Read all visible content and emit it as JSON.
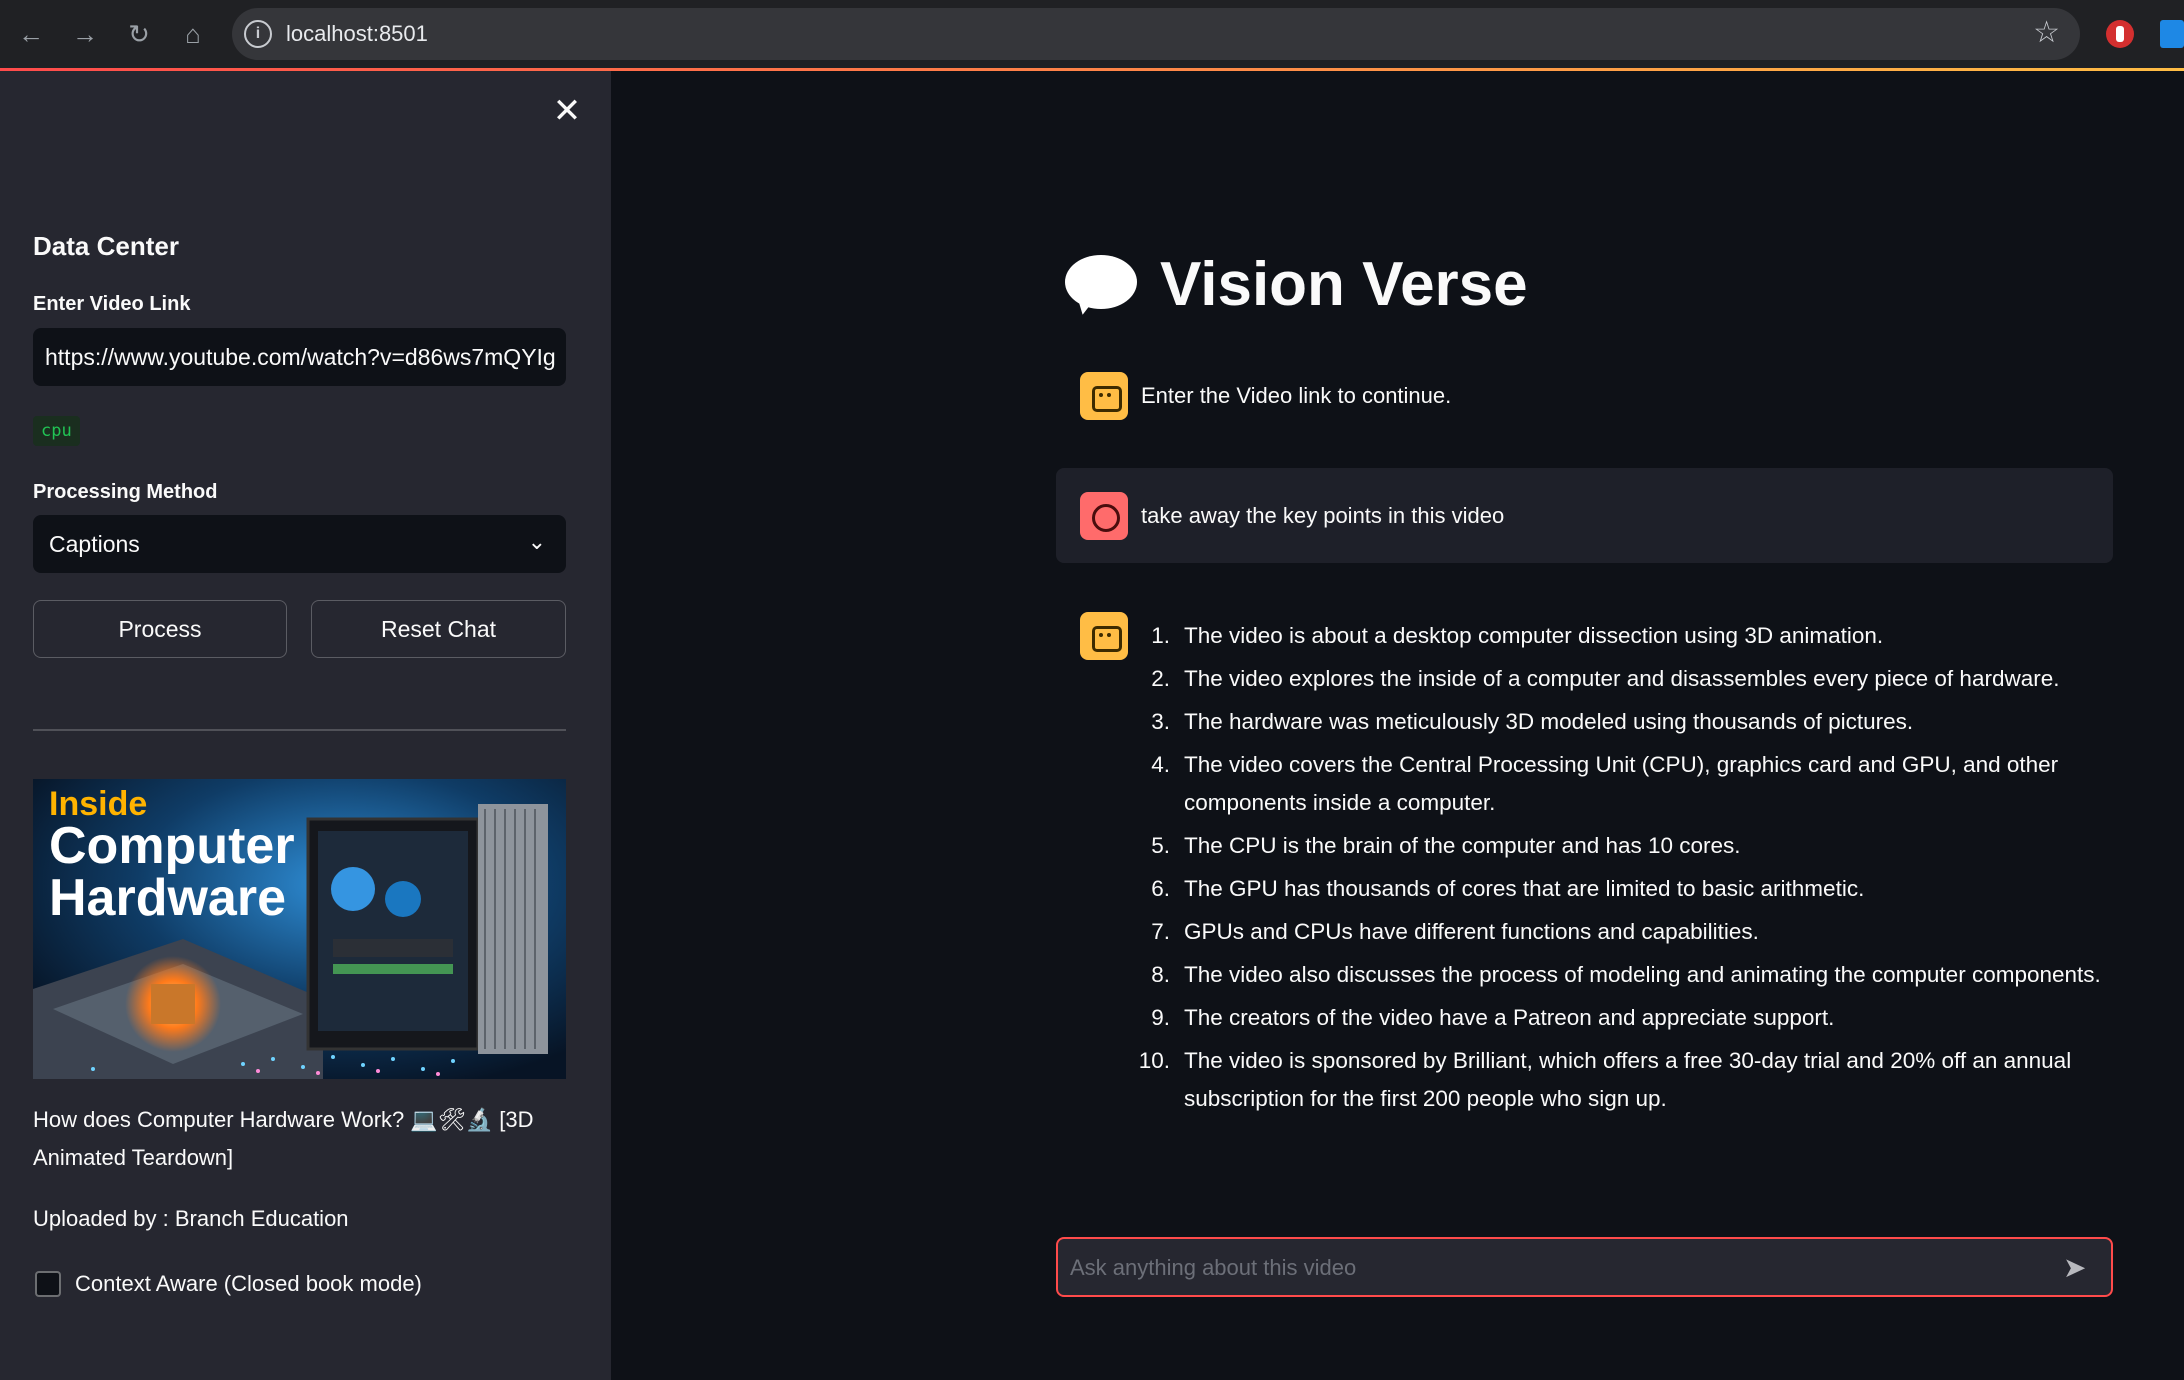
{
  "browser": {
    "url": "localhost:8501"
  },
  "sidebar": {
    "title": "Data Center",
    "video_link_label": "Enter Video Link",
    "video_link_value": "https://www.youtube.com/watch?v=d86ws7mQYIg",
    "device_badge": "cpu",
    "processing_label": "Processing Method",
    "processing_selected": "Captions",
    "process_button": "Process",
    "reset_button": "Reset Chat",
    "thumbnail": {
      "line_inside": "Inside",
      "line_1": "Computer",
      "line_2": "Hardware"
    },
    "video_title": "How does Computer Hardware Work? 💻🛠🔬 [3D Animated Teardown]",
    "uploaded_by": "Uploaded by : Branch Education",
    "context_aware_label": "Context Aware (Closed book mode)",
    "context_aware_checked": false
  },
  "main": {
    "title": "Vision Verse",
    "messages": [
      {
        "role": "assistant",
        "text": "Enter the Video link to continue."
      },
      {
        "role": "user",
        "text": "take away the key points in this video"
      }
    ],
    "answer_points": [
      {
        "num": "1.",
        "text": "The video is about a desktop computer dissection using 3D animation."
      },
      {
        "num": "2.",
        "text": "The video explores the inside of a computer and disassembles every piece of hardware."
      },
      {
        "num": "3.",
        "text": "The hardware was meticulously 3D modeled using thousands of pictures."
      },
      {
        "num": "4.",
        "text": "The video covers the Central Processing Unit (CPU), graphics card and GPU, and other components inside a computer."
      },
      {
        "num": "5.",
        "text": "The CPU is the brain of the computer and has 10 cores."
      },
      {
        "num": "6.",
        "text": "The GPU has thousands of cores that are limited to basic arithmetic."
      },
      {
        "num": "7.",
        "text": "GPUs and CPUs have different functions and capabilities."
      },
      {
        "num": "8.",
        "text": "The video also discusses the process of modeling and animating the computer components."
      },
      {
        "num": "9.",
        "text": "The creators of the video have a Patreon and appreciate support."
      },
      {
        "num": "10.",
        "text": "The video is sponsored by Brilliant, which offers a free 30-day trial and 20% off an annual subscription for the first 200 people who sign up."
      }
    ],
    "chat_placeholder": "Ask anything about this video"
  },
  "colors": {
    "background": "#0e1117",
    "sidebar": "#262730",
    "accent": "#ff4b4b",
    "bot_avatar": "#ffbd45",
    "user_avatar": "#ff6b6b",
    "badge_text": "#21c354"
  }
}
